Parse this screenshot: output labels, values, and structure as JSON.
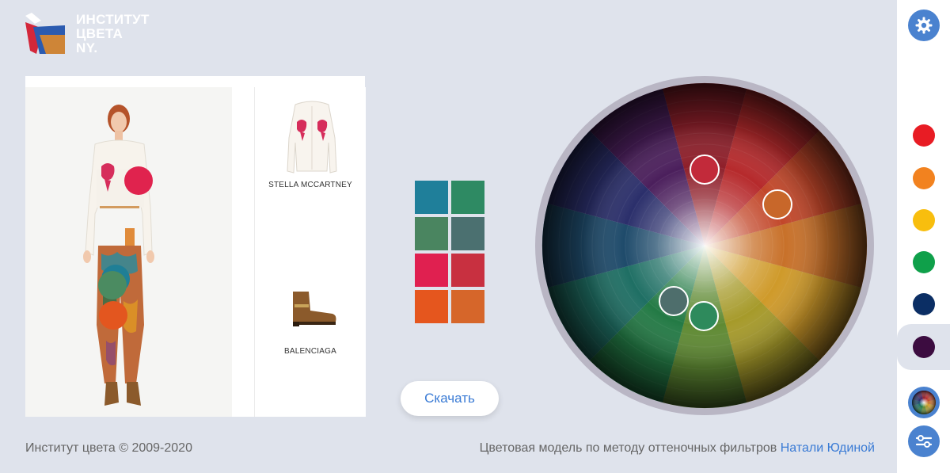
{
  "logo": {
    "line1": "ИНСТИТУТ",
    "line2": "ЦВЕТА",
    "line3": "NY."
  },
  "products": [
    {
      "brand": "STELLA MCCARTNEY"
    },
    {
      "brand": "BALENCIAGA"
    }
  ],
  "model_markers": [
    {
      "color": "#e0234e"
    },
    {
      "color": "#1f7f96"
    },
    {
      "color": "#4b8b61"
    },
    {
      "color": "#e3561f"
    }
  ],
  "palette": {
    "swatches": [
      "#1f7f9a",
      "#2e8a63",
      "#4a8560",
      "#4b7070",
      "#e02050",
      "#c83040",
      "#e5561e",
      "#d6662a"
    ]
  },
  "download": {
    "label": "Скачать"
  },
  "wheel_markers": [
    {
      "color": "#c22a3a"
    },
    {
      "color": "#c8672a"
    },
    {
      "color": "#4e6e6c"
    },
    {
      "color": "#2e8a5c"
    }
  ],
  "footer": {
    "copyright": "Институт цвета © 2009-2020",
    "model_text": "Цветовая модель по методу оттеночных фильтров",
    "author": "Натали Юдиной"
  },
  "sidebar": {
    "colors": [
      "#e81c24",
      "#f2821f",
      "#f8be0e",
      "#0fa04a",
      "#0b2e64",
      "#3c0c40"
    ],
    "settings_icon": "gear-icon",
    "wheel_icon": "color-wheel-icon",
    "filters_icon": "sliders-icon"
  }
}
